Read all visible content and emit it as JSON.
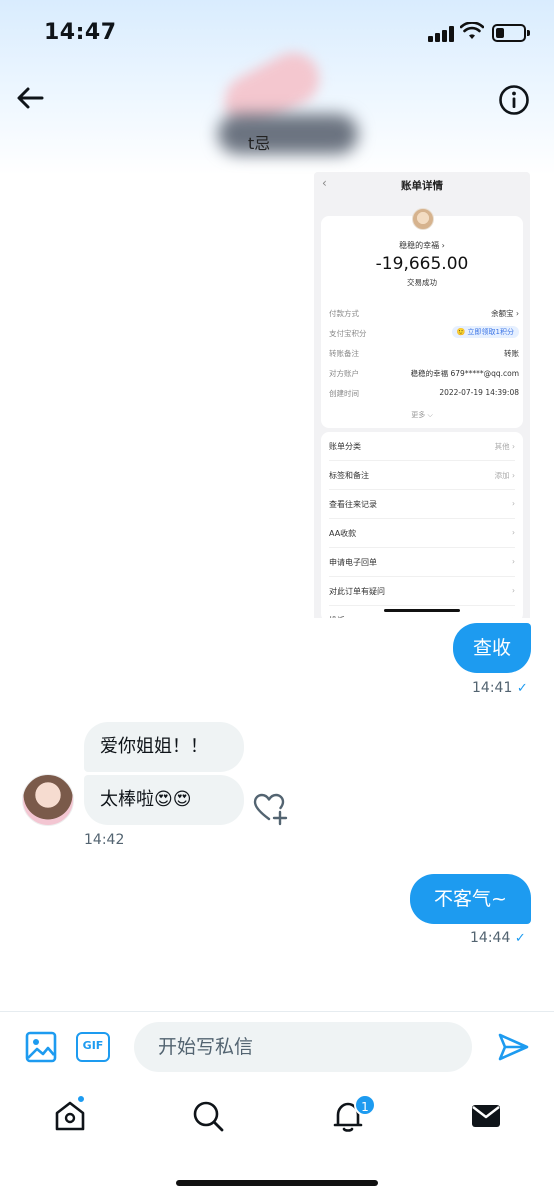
{
  "status_bar": {
    "time": "14:47"
  },
  "header": {
    "name_fragment": "t忌"
  },
  "screenshot": {
    "title": "账单详情",
    "payee": "稳稳的幸福 ›",
    "amount": "-19,665.00",
    "status": "交易成功",
    "details": [
      {
        "key": "付款方式",
        "value": "余额宝 ›"
      },
      {
        "key": "支付宝积分",
        "value": "🙂 立即领取1积分"
      },
      {
        "key": "转账备注",
        "value": "转账"
      },
      {
        "key": "对方账户",
        "value": "稳稳的幸福 679*****@qq.com"
      },
      {
        "key": "创建时间",
        "value": "2022-07-19 14:39:08"
      }
    ],
    "more": "更多 ⌵",
    "rows": [
      {
        "label": "账单分类",
        "value": "其他 ›"
      },
      {
        "label": "标签和备注",
        "value": "添加 ›"
      },
      {
        "label": "查看往来记录",
        "value": "›"
      },
      {
        "label": "AA收款",
        "value": "›"
      },
      {
        "label": "申请电子回单",
        "value": "›"
      },
      {
        "label": "对此订单有疑问",
        "value": "›"
      },
      {
        "label": "投诉",
        "value": "›"
      }
    ]
  },
  "messages": {
    "out1": {
      "text": "查收",
      "time": "14:41",
      "tick": "✓"
    },
    "in1": {
      "text": "爱你姐姐！！"
    },
    "in2": {
      "text": "太棒啦😍😍",
      "time": "14:42"
    },
    "out2": {
      "text": "不客气~",
      "time": "14:44",
      "tick": "✓"
    }
  },
  "composer": {
    "placeholder": "开始写私信",
    "gif_label": "GIF"
  },
  "nav": {
    "notifications_count": "1"
  },
  "colors": {
    "accent": "#1d9bf0",
    "bubble_gray": "#eff3f4"
  }
}
